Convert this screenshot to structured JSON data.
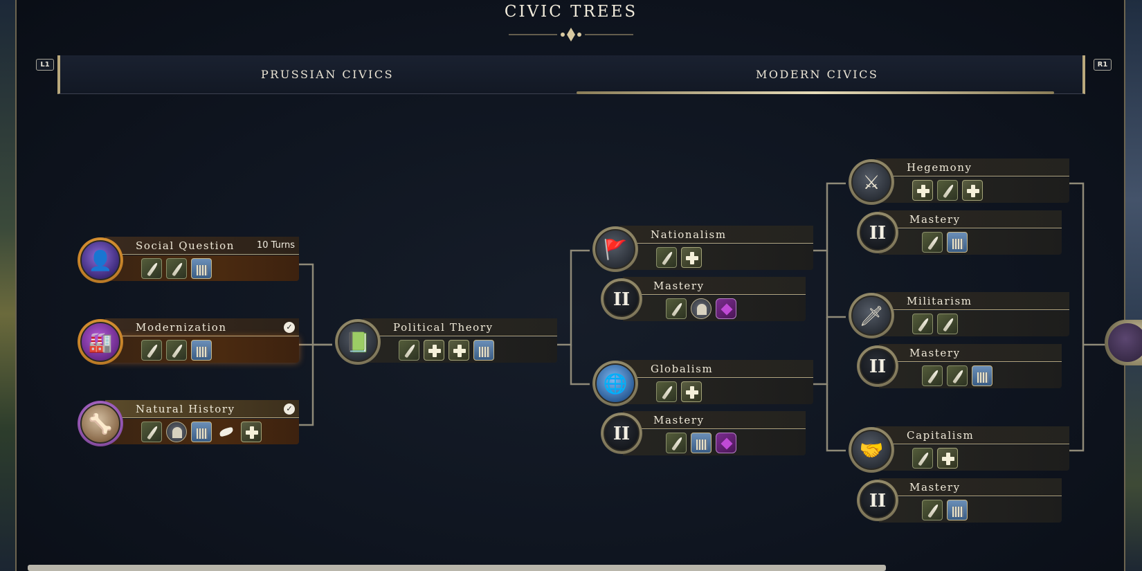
{
  "header": {
    "title": "CIVIC TREES",
    "left_hint": "L1",
    "right_hint": "R1"
  },
  "tabs": [
    {
      "label": "PRUSSIAN CIVICS",
      "active": false
    },
    {
      "label": "MODERN CIVICS",
      "active": true
    }
  ],
  "nodes": {
    "social_question": {
      "name": "Social Question",
      "status": "10 Turns",
      "icons": [
        "quill",
        "quill",
        "building"
      ]
    },
    "modernization": {
      "name": "Modernization",
      "status": "✓",
      "icons": [
        "quill",
        "quill",
        "building"
      ]
    },
    "natural_history": {
      "name": "Natural History",
      "status": "✓",
      "icons": [
        "quill",
        "wonder",
        "building",
        "unit",
        "plus"
      ]
    },
    "political_theory": {
      "name": "Political Theory",
      "icons": [
        "quill",
        "plus",
        "plus",
        "building"
      ]
    },
    "nationalism": {
      "name": "Nationalism",
      "icons": [
        "quill",
        "plus"
      ]
    },
    "nationalism_mastery": {
      "name": "Mastery",
      "tier": "II",
      "icons": [
        "quill",
        "wonder",
        "gem"
      ]
    },
    "globalism": {
      "name": "Globalism",
      "icons": [
        "quill",
        "plus"
      ]
    },
    "globalism_mastery": {
      "name": "Mastery",
      "tier": "II",
      "icons": [
        "quill",
        "building",
        "gem"
      ]
    },
    "hegemony": {
      "name": "Hegemony",
      "icons": [
        "plus",
        "quill",
        "plus"
      ]
    },
    "hegemony_mastery": {
      "name": "Mastery",
      "tier": "II",
      "icons": [
        "quill",
        "building"
      ]
    },
    "militarism": {
      "name": "Militarism",
      "icons": [
        "quill",
        "quill"
      ]
    },
    "militarism_mastery": {
      "name": "Mastery",
      "tier": "II",
      "icons": [
        "quill",
        "quill",
        "building"
      ]
    },
    "capitalism": {
      "name": "Capitalism",
      "icons": [
        "quill",
        "plus"
      ]
    },
    "capitalism_mastery": {
      "name": "Mastery",
      "tier": "II",
      "icons": [
        "quill",
        "building"
      ]
    }
  },
  "colors": {
    "accent_gold": "#b9a87c",
    "researching_brown": "#4a2a10",
    "civic_purple": "#5a2a88"
  }
}
